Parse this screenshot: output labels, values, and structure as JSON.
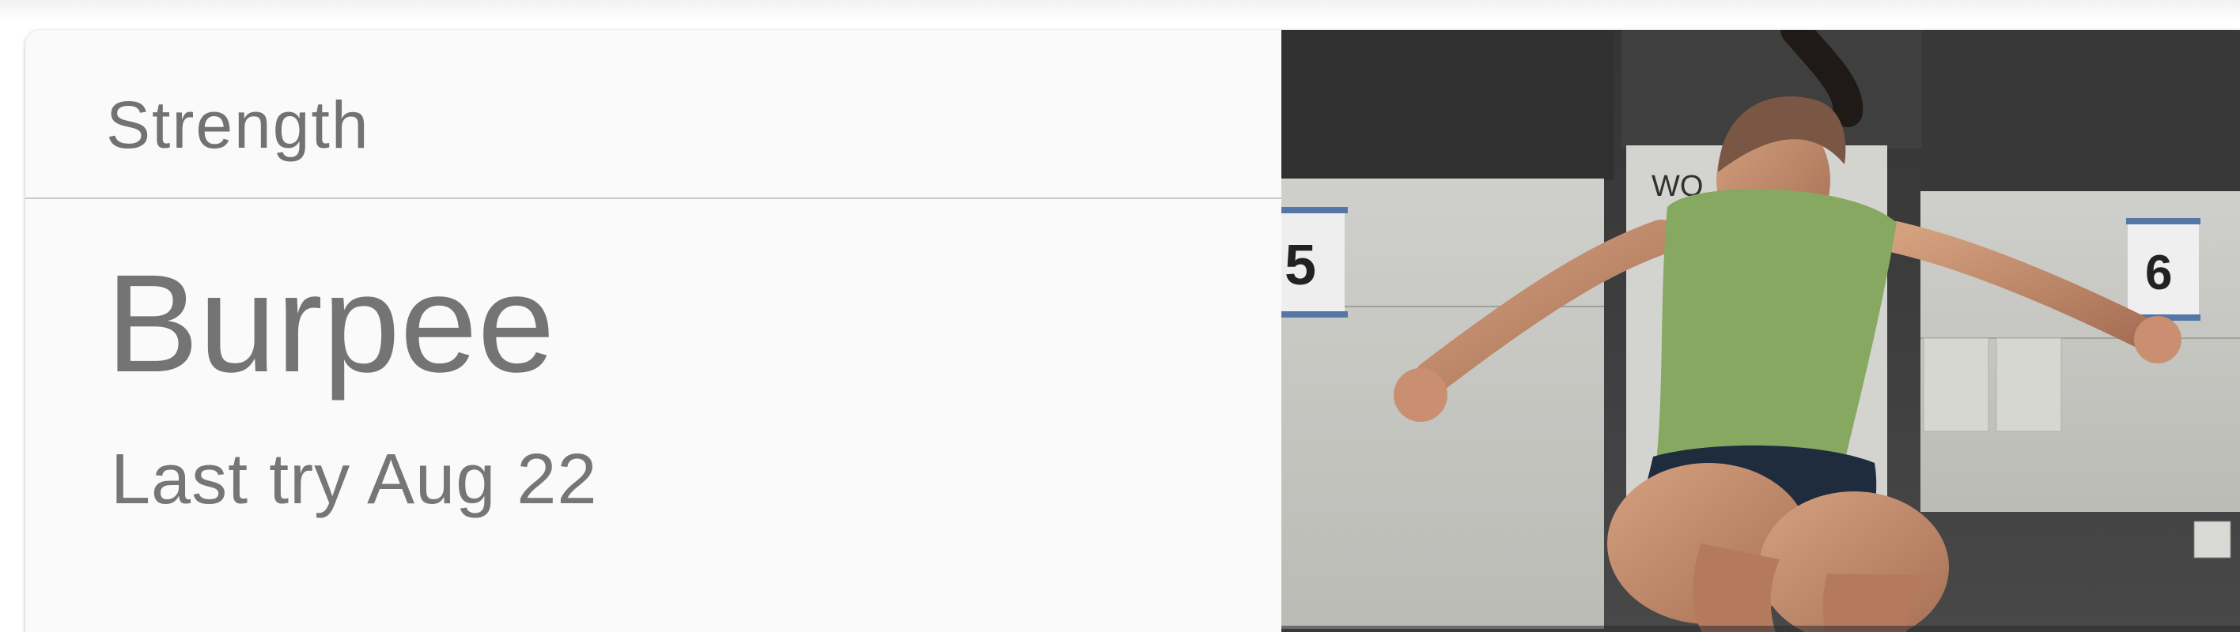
{
  "card": {
    "category": "Strength",
    "exercise_name": "Burpee",
    "last_try": "Last try Aug 22"
  },
  "photo": {
    "wall_labels": [
      "5",
      "6"
    ],
    "poster_text": "WO"
  },
  "colors": {
    "card_background": "#fafafa",
    "text_primary": "#747474",
    "divider": "#c9c9c9",
    "tank_top": "#86a860",
    "gym_wall": "#3e3e3e"
  }
}
